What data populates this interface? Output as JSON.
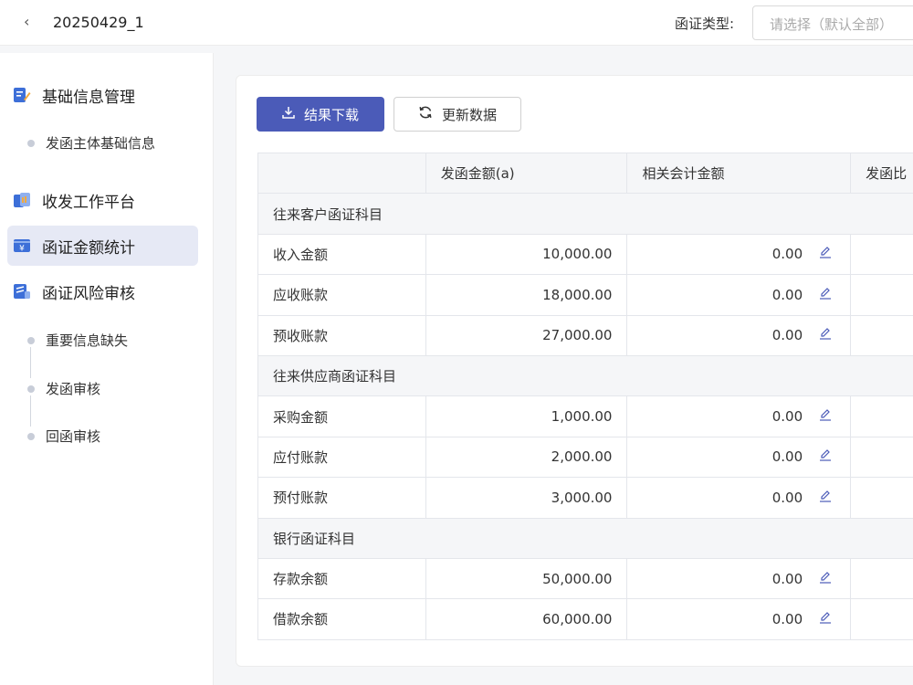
{
  "header": {
    "back_glyph": "‹",
    "title": "20250429_1",
    "filter_label": "函证类型:",
    "filter_placeholder": "请选择（默认全部）"
  },
  "sidebar": {
    "groups": [
      {
        "label": "基础信息管理",
        "icon": "doc-pen-icon"
      },
      {
        "label": "收发工作平台",
        "icon": "workbench-icon"
      },
      {
        "label": "函证金额统计",
        "icon": "yen-card-icon"
      },
      {
        "label": "函证风险审核",
        "icon": "doc-check-icon"
      }
    ],
    "sub_items": {
      "basic": [
        "发函主体基础信息"
      ],
      "risk": [
        "重要信息缺失",
        "发函审核",
        "回函审核"
      ]
    }
  },
  "toolbar": {
    "download_label": "结果下载",
    "refresh_label": "更新数据"
  },
  "table": {
    "headers": [
      "",
      "发函金额(a)",
      "相关会计金额",
      "发函比"
    ],
    "groups": [
      {
        "title": "往来客户函证科目",
        "rows": [
          {
            "name": "收入金额",
            "amount": "10,000.00",
            "accounting": "0.00"
          },
          {
            "name": "应收账款",
            "amount": "18,000.00",
            "accounting": "0.00"
          },
          {
            "name": "预收账款",
            "amount": "27,000.00",
            "accounting": "0.00"
          }
        ]
      },
      {
        "title": "往来供应商函证科目",
        "rows": [
          {
            "name": "采购金额",
            "amount": "1,000.00",
            "accounting": "0.00"
          },
          {
            "name": "应付账款",
            "amount": "2,000.00",
            "accounting": "0.00"
          },
          {
            "name": "预付账款",
            "amount": "3,000.00",
            "accounting": "0.00"
          }
        ]
      },
      {
        "title": "银行函证科目",
        "rows": [
          {
            "name": "存款余额",
            "amount": "50,000.00",
            "accounting": "0.00"
          },
          {
            "name": "借款余额",
            "amount": "60,000.00",
            "accounting": "0.00"
          }
        ]
      }
    ]
  },
  "colors": {
    "primary": "#4b5bb8",
    "active_bg": "#e6e9f5",
    "icon_blue": "#3d6fd8"
  }
}
